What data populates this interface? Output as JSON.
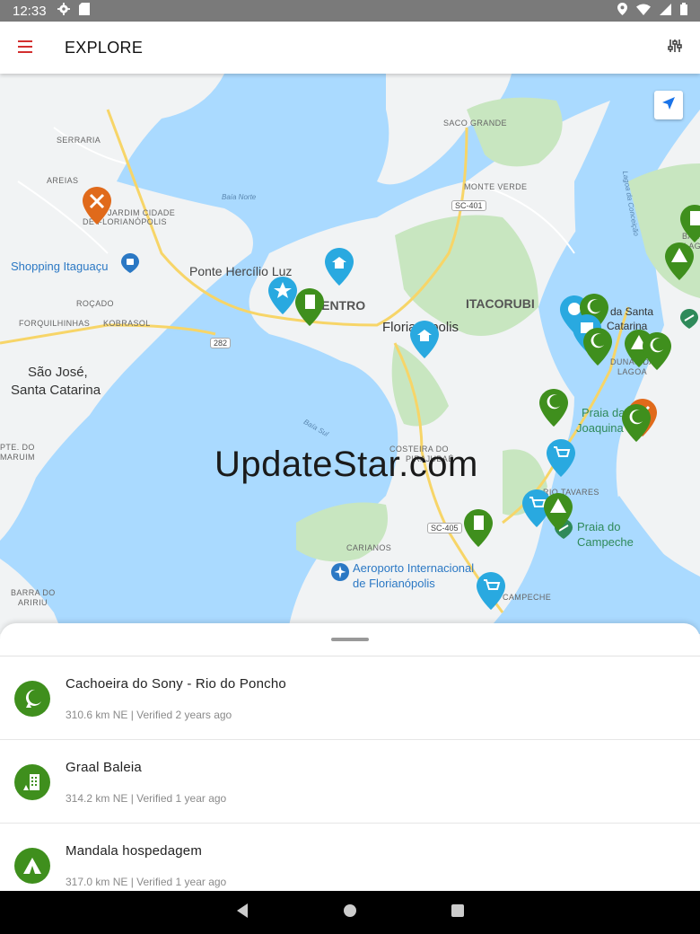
{
  "status_bar": {
    "time": "12:33"
  },
  "app_bar": {
    "title": "EXPLORE"
  },
  "map": {
    "labels": {
      "serraria": "SERRARIA",
      "areias": "AREIAS",
      "jardim": "JARDIM CIDADE",
      "jardim2": "DE FLORIANÓPOLIS",
      "shopping": "Shopping Itaguaçu",
      "rocado": "ROÇADO",
      "forquilhinhas": "FORQUILHINHAS",
      "kobrasol": "KOBRASOL",
      "sao_jose": "São José,",
      "santa_catarina": "Santa Catarina",
      "pte_do": "PTE. DO",
      "maruim": "MARUIM",
      "barra_do": "BARRA DO",
      "ariri": "ARIRIU",
      "baia_norte": "Baía Norte",
      "baia_sul": "Baía Sul",
      "saco_grande": "SACO GRANDE",
      "monte_verde": "MONTE VERDE",
      "ponte": "Ponte Hercílio Luz",
      "centro": "CENTRO",
      "itacorubi": "ITACORUBI",
      "florianopolis": "Florianópolis",
      "costeira": "COSTEIRA DO",
      "pirajubae": "PIRAJUBAÉ",
      "rio_tavares": "RIO TAVARES",
      "carianos": "CARIANOS",
      "aeroporto": "Aeroporto Internacional",
      "aeroporto2": "de Florianópolis",
      "campeche": "CAMPECHE",
      "praia_campeche": "Praia do",
      "praia_campeche2": "Campeche",
      "joaquina": "Praia da",
      "joaquina2": "Joaquina",
      "lagoa": "da Santa",
      "lagoa2": "Catarina",
      "dunas": "DUNAS DA",
      "dunas2": "LAGOA",
      "lagoa_conceicao": "Lagoa da Conceição",
      "barra_lagoa": "BARRA DA",
      "barra_lagoa2": "LAGOA"
    },
    "routes": {
      "r282": "282",
      "sc401": "SC-401",
      "sc405": "SC-405"
    },
    "watermark": "UpdateStar.com"
  },
  "places": [
    {
      "name": "Cachoeira do Sony - Rio do Poncho",
      "meta": "310.6 km NE | Verified 2 years ago",
      "icon": "moon-tent-icon"
    },
    {
      "name": "Graal Baleia",
      "meta": "314.2 km NE | Verified 1 year ago",
      "icon": "hotel-icon"
    },
    {
      "name": "Mandala hospedagem",
      "meta": "317.0 km NE | Verified 1 year ago",
      "icon": "tent-icon"
    }
  ],
  "colors": {
    "accent": "#d32f2f",
    "green": "#3f8f1d",
    "blue": "#29a9e0",
    "orange": "#e06a1b",
    "water": "#aadaff",
    "land": "#f1f3f4",
    "park": "#c8e6c0"
  }
}
